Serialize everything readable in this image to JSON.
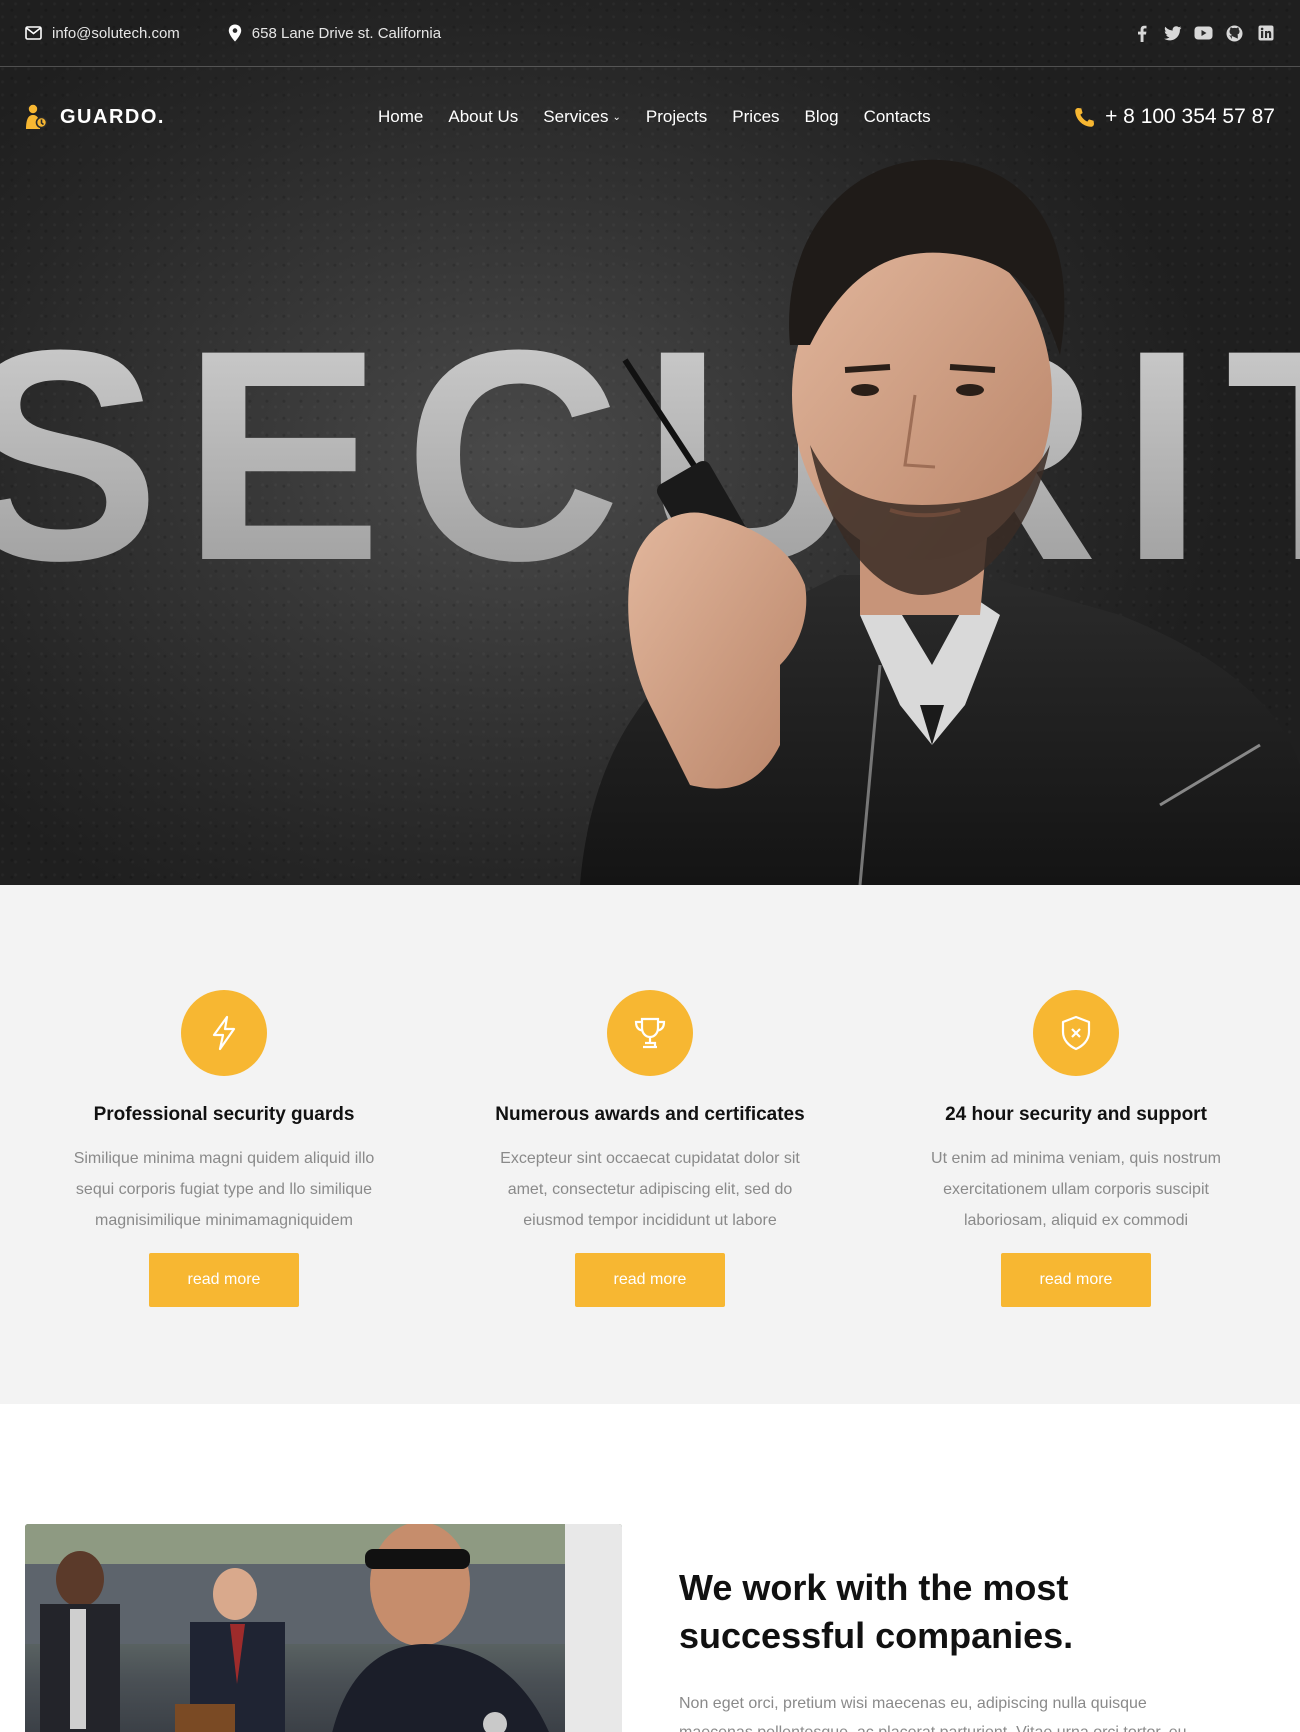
{
  "topbar": {
    "email": "info@solutech.com",
    "address": "658 Lane Drive st. California",
    "social": [
      "facebook-icon",
      "twitter-icon",
      "youtube-icon",
      "github-icon",
      "linkedin-icon"
    ]
  },
  "navbar": {
    "logo": "GUARDO.",
    "menu": [
      "Home",
      "About Us",
      "Services",
      "Projects",
      "Prices",
      "Blog",
      "Contacts"
    ],
    "phone": "+ 8 100 354 57 87"
  },
  "hero": {
    "big_word": "SECURITY"
  },
  "features": [
    {
      "icon": "lightning-icon",
      "title": "Professional security guards",
      "text": "Similique minima magni quidem aliquid illo sequi corporis fugiat type and llo similique magnisimilique minimamagniquidem",
      "button": "read more"
    },
    {
      "icon": "trophy-icon",
      "title": "Numerous awards and certificates",
      "text": "Excepteur sint occaecat cupidatat dolor sit amet, consectetur adipiscing elit, sed do eiusmod tempor incididunt ut labore",
      "button": "read more"
    },
    {
      "icon": "shield-icon",
      "title": "24 hour security and support",
      "text": "Ut enim ad minima veniam, quis nostrum exercitationem ullam corporis suscipit laboriosam, aliquid ex commodi",
      "button": "read more"
    }
  ],
  "about": {
    "heading": "We work with the most successful companies.",
    "text": "Non eget orci, pretium wisi maecenas eu, adipiscing nulla quisque maecenas pellentesque, ac placerat parturient. Vitae urna orci tortor, eu"
  },
  "colors": {
    "accent": "#f7b732",
    "dark": "#2a2a2a",
    "section_bg": "#f3f3f3"
  }
}
